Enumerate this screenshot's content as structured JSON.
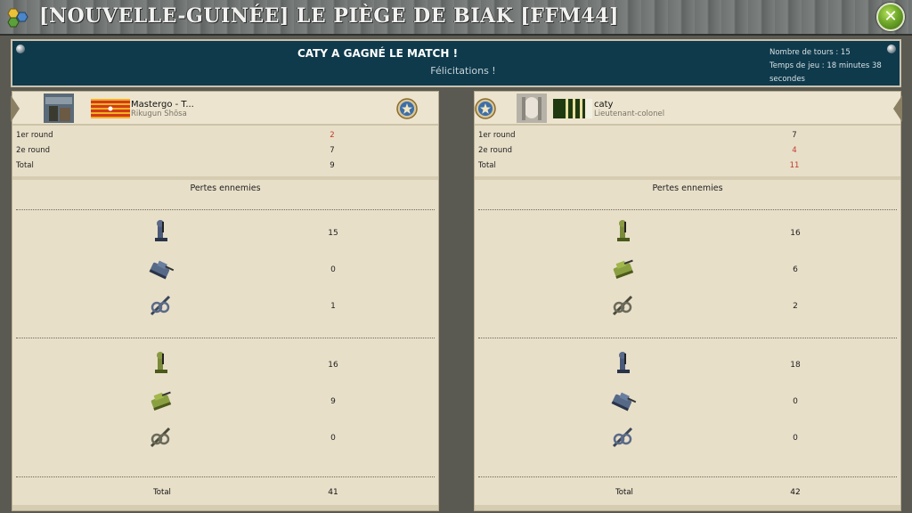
{
  "window": {
    "title": "[NOUVELLE-GUINÉE] LE PIÈGE DE BIAK [FFM44]",
    "close_icon": "close-x-icon"
  },
  "banner": {
    "headline": "CATY A GAGNÉ LE MATCH !",
    "subtitle": "Félicitations !",
    "turns": "Nombre de tours : 15",
    "playtime": "Temps de jeu : 18 minutes 38 secondes"
  },
  "left": {
    "name": "Mastergo - T...",
    "rank": "Rikugun Shōsa",
    "rounds": [
      {
        "label": "1er round",
        "value": "2",
        "color": "#c0392b"
      },
      {
        "label": "2e round",
        "value": "7",
        "color": "#222222"
      },
      {
        "label": "Total",
        "value": "9",
        "color": "#222222"
      }
    ],
    "section_title": "Pertes ennemies",
    "group1": [
      {
        "icon": "axis-infantry-icon",
        "value": "15"
      },
      {
        "icon": "axis-tank-icon",
        "value": "0"
      },
      {
        "icon": "axis-artillery-icon",
        "value": "1"
      }
    ],
    "group2": [
      {
        "icon": "allied-infantry-icon",
        "value": "16"
      },
      {
        "icon": "allied-tank-icon",
        "value": "9"
      },
      {
        "icon": "artillery-icon",
        "value": "0"
      }
    ],
    "total_label": "Total",
    "total_value": "41"
  },
  "right": {
    "name": "caty",
    "rank": "Lieutenant-colonel",
    "rounds": [
      {
        "label": "1er round",
        "value": "7",
        "color": "#222222"
      },
      {
        "label": "2e round",
        "value": "4",
        "color": "#c0392b"
      },
      {
        "label": "Total",
        "value": "11",
        "color": "#c0392b"
      }
    ],
    "section_title": "Pertes ennemies",
    "group1": [
      {
        "icon": "allied-infantry-icon",
        "value": "16"
      },
      {
        "icon": "allied-tank-icon",
        "value": "6"
      },
      {
        "icon": "artillery-icon",
        "value": "2"
      }
    ],
    "group2": [
      {
        "icon": "axis-infantry-icon",
        "value": "18"
      },
      {
        "icon": "axis-tank-icon",
        "value": "0"
      },
      {
        "icon": "axis-artillery-icon",
        "value": "0"
      }
    ],
    "total_label": "Total",
    "total_value": "42"
  }
}
